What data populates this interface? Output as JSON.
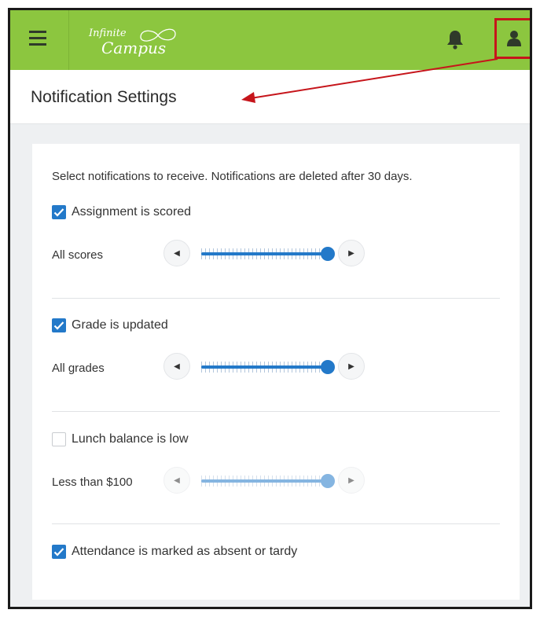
{
  "app": {
    "logo_line1": "Infinite",
    "logo_line2": "Campus"
  },
  "header": {
    "title": "Notification Settings"
  },
  "content": {
    "intro": "Select notifications to receive. Notifications are deleted after 30 days.",
    "settings": [
      {
        "label": "Assignment is scored",
        "checked": true,
        "slider_label": "All scores",
        "slider_value": 1.0
      },
      {
        "label": "Grade is updated",
        "checked": true,
        "slider_label": "All grades",
        "slider_value": 1.0
      },
      {
        "label": "Lunch balance is low",
        "checked": false,
        "slider_label": "Less than $100",
        "slider_value": 1.0
      },
      {
        "label": "Attendance is marked as absent or tardy",
        "checked": true
      }
    ]
  },
  "icons": {
    "menu": "hamburger-menu-icon",
    "notifications": "bell-icon",
    "user": "user-icon",
    "slider_left": "caret-left-icon",
    "slider_right": "caret-right-icon",
    "check": "check-icon"
  },
  "colors": {
    "topbar": "#8cc63f",
    "accent": "#2379c9",
    "highlight": "#c6151b"
  }
}
